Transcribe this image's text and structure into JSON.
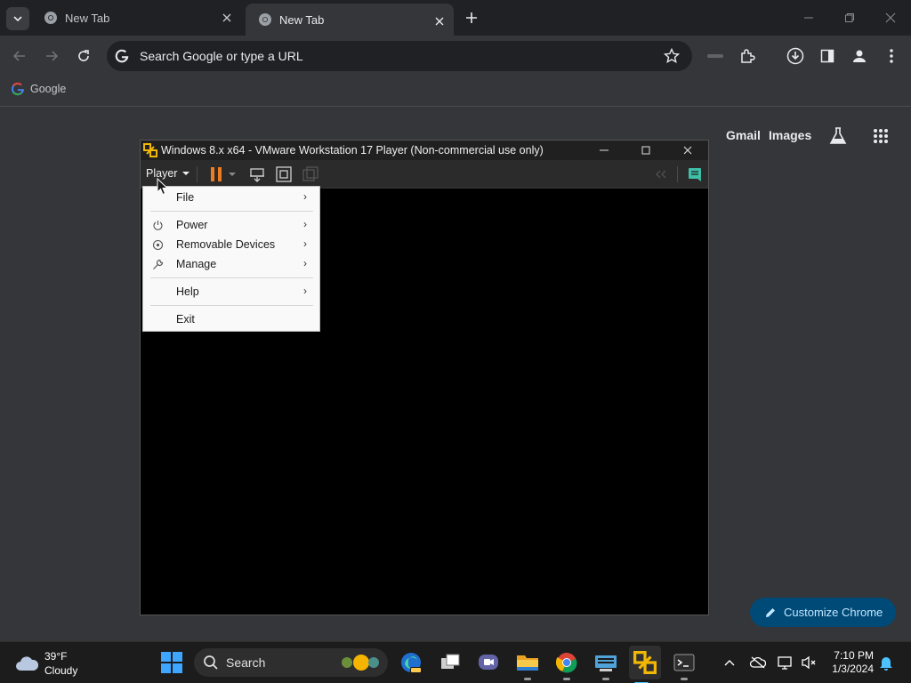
{
  "browser": {
    "tabs": [
      {
        "title": "New Tab",
        "active": false
      },
      {
        "title": "New Tab",
        "active": true
      }
    ],
    "omnibox": {
      "placeholder": "Search Google or type a URL"
    },
    "bookmarks": [
      {
        "label": "Google"
      }
    ]
  },
  "ntp": {
    "gmail_label": "Gmail",
    "images_label": "Images",
    "customize_label": "Customize Chrome"
  },
  "vmware": {
    "title": "Windows 8.x x64 - VMware Workstation 17 Player (Non-commercial use only)",
    "player_menu_label": "Player",
    "menu": {
      "file": "File",
      "power": "Power",
      "removable_devices": "Removable Devices",
      "manage": "Manage",
      "help": "Help",
      "exit": "Exit"
    },
    "pause_color": "#f07c21"
  },
  "taskbar": {
    "weather_temp": "39°F",
    "weather_desc": "Cloudy",
    "search_label": "Search",
    "time": "7:10 PM",
    "date": "1/3/2024"
  },
  "colors": {
    "tabstrip_bg": "#202124",
    "toolbar_bg": "#35363a",
    "customize_bg": "#004a77",
    "accent_blue": "#4cc2ff"
  }
}
